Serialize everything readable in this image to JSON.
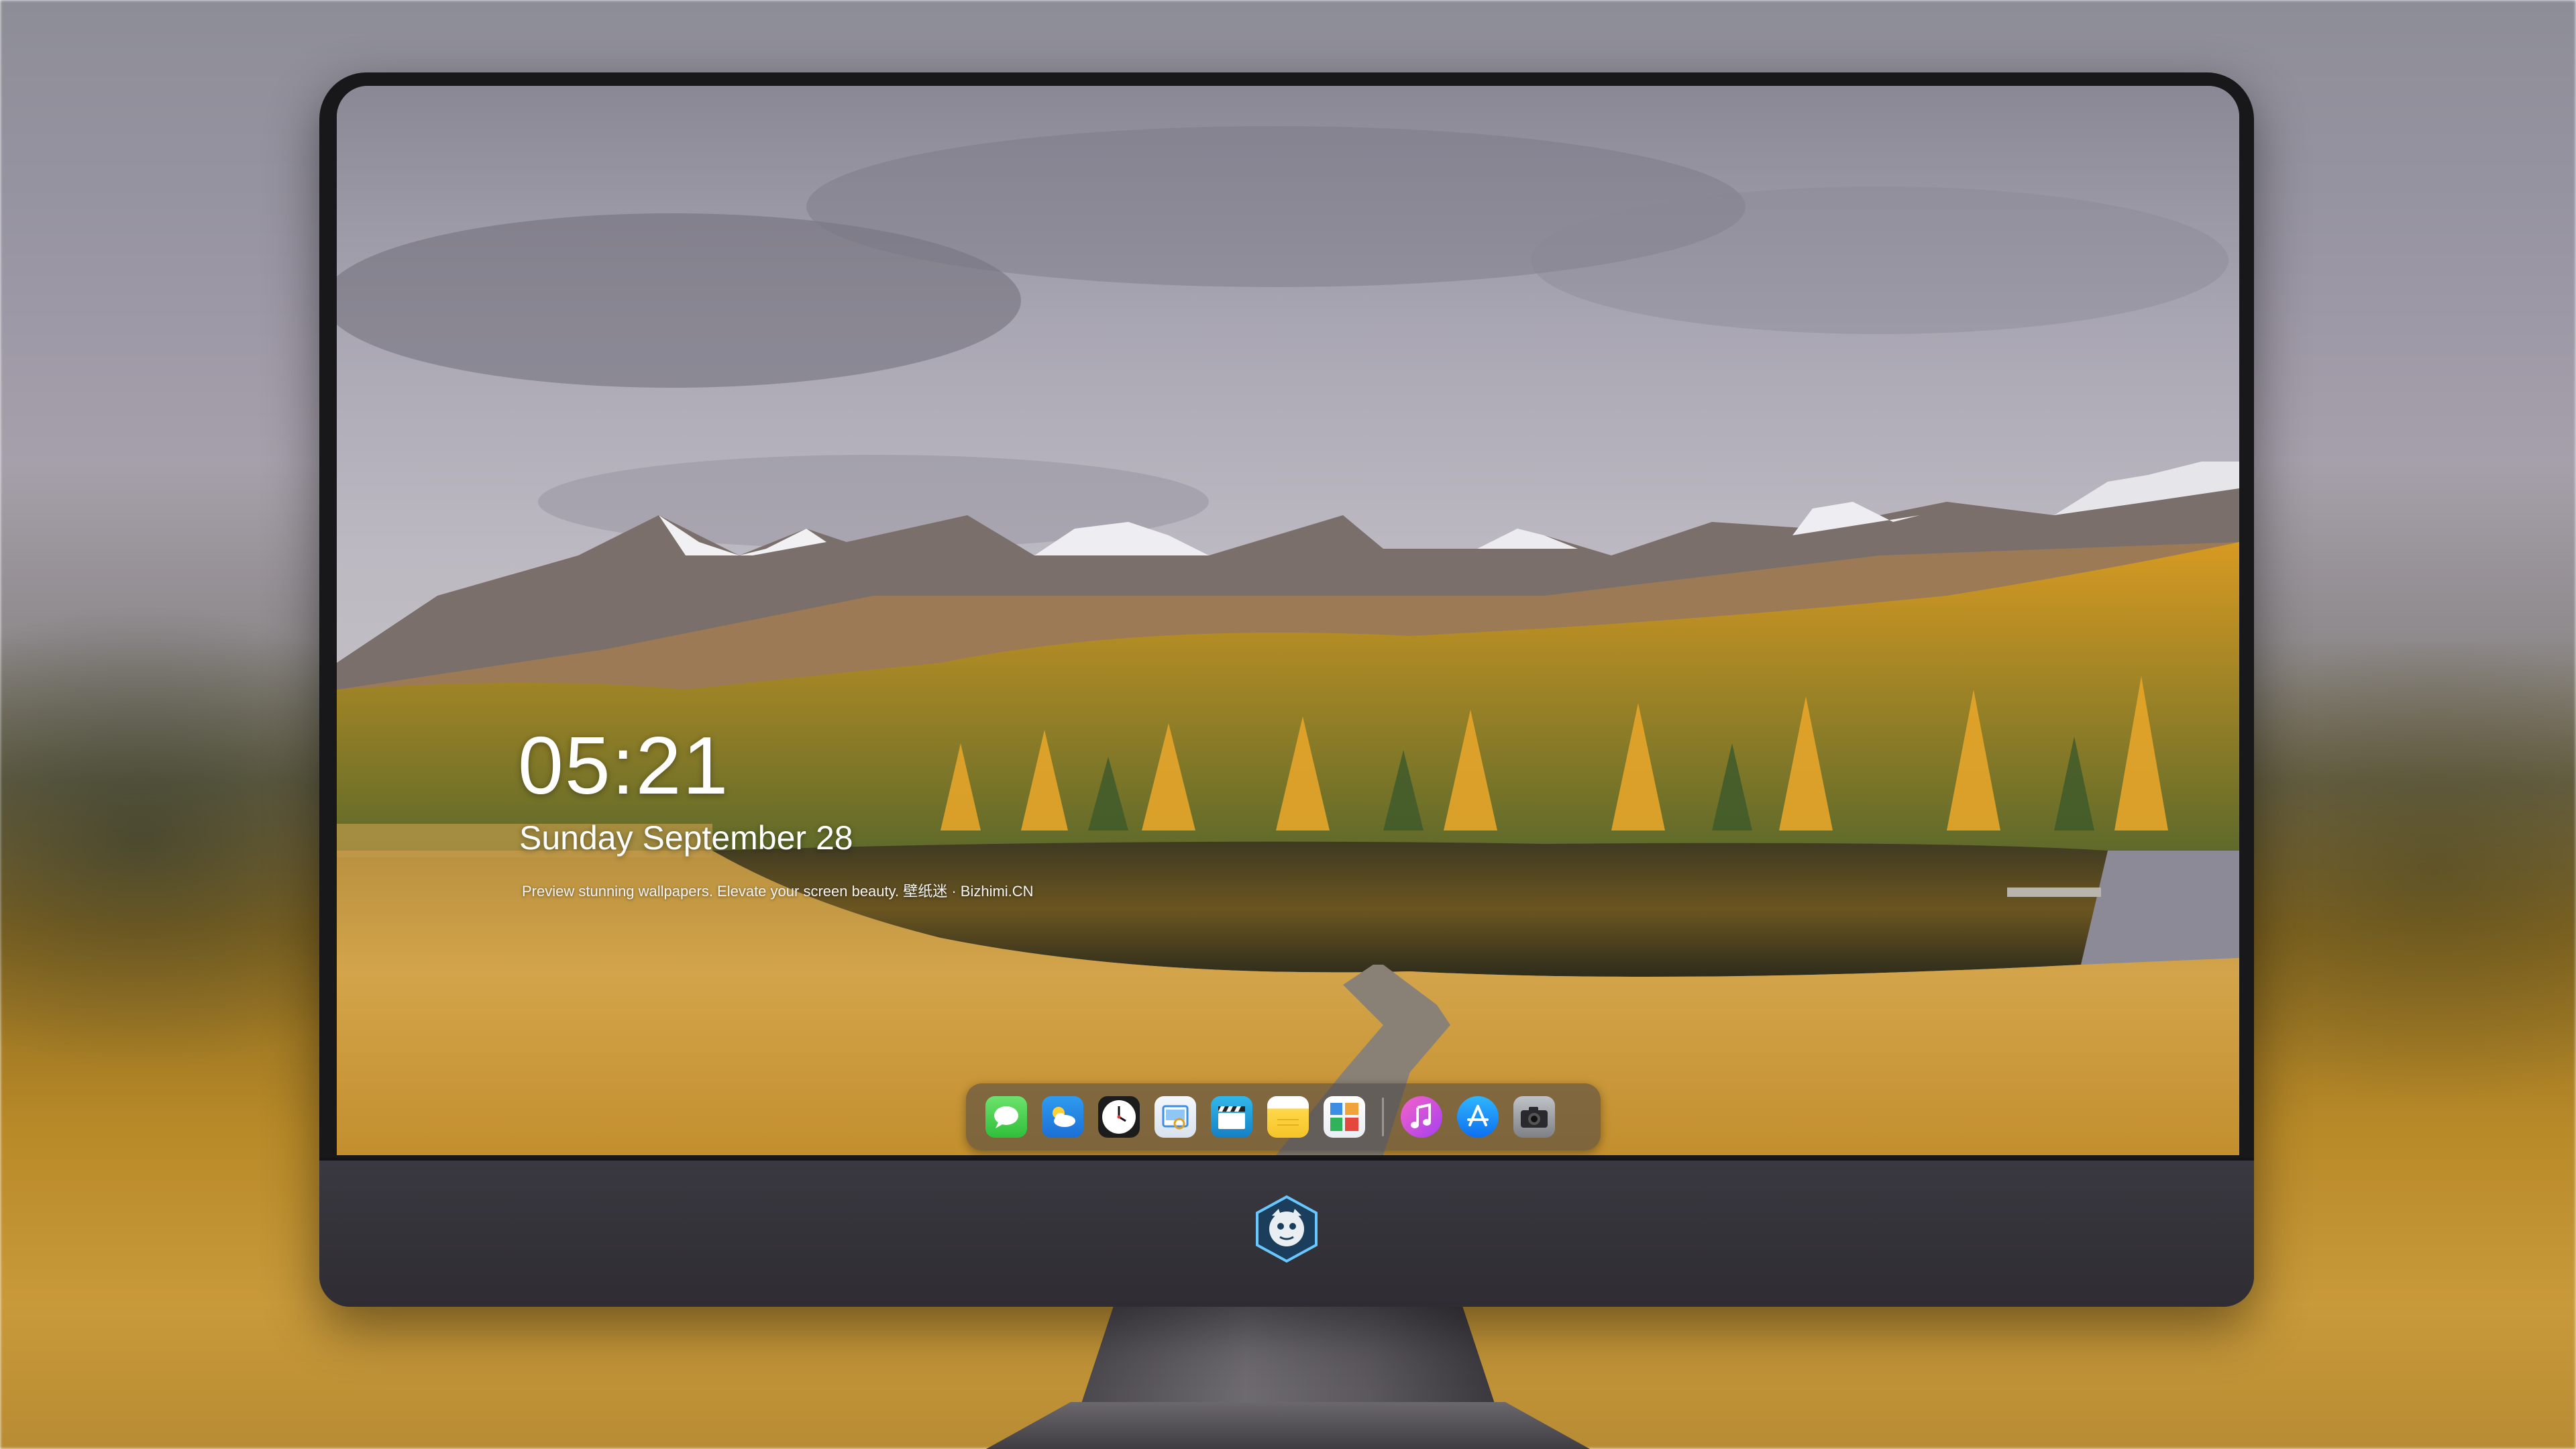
{
  "lockscreen": {
    "time": "05:21",
    "date": "Sunday September  28",
    "tagline": "Preview stunning wallpapers. Elevate your screen beauty. 壁纸迷 · Bizhimi.CN"
  },
  "dock": {
    "items": [
      {
        "name": "messages",
        "icon": "chat-bubble-icon",
        "color": "#3ecf45"
      },
      {
        "name": "weather",
        "icon": "cloud-sun-icon",
        "color": "#2b8ce8"
      },
      {
        "name": "clock",
        "icon": "clock-icon",
        "color": "#1c1c1c"
      },
      {
        "name": "preview",
        "icon": "preview-icon",
        "color": "#e6edf5"
      },
      {
        "name": "clips",
        "icon": "clapperboard-icon",
        "color": "#1f9ad8"
      },
      {
        "name": "notes",
        "icon": "notes-icon",
        "color": "#f7cd33"
      },
      {
        "name": "photo-gallery",
        "icon": "gallery-icon",
        "color": "#f2f5f8"
      },
      {
        "name": "music",
        "icon": "music-note-icon",
        "color": "#d050e0"
      },
      {
        "name": "app-store",
        "icon": "app-store-icon",
        "color": "#1a8ff5"
      },
      {
        "name": "camera",
        "icon": "camera-icon",
        "color": "#9a9da1"
      }
    ]
  },
  "colors": {
    "sky": "#9c99a6",
    "larch_gold": "#e2a22a",
    "grass": "#c99a3c",
    "monitor_bezel": "#18181b",
    "monitor_chin": "#35333a"
  }
}
